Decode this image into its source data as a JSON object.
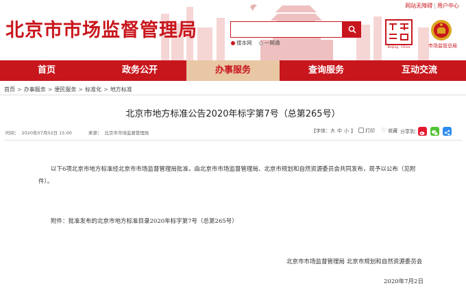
{
  "header": {
    "site_title": "北京市市场监督管理局",
    "top_links": [
      "网站无障碍",
      "用户中心"
    ],
    "search": {
      "placeholder": "",
      "options": [
        "搜本网",
        "一网通"
      ]
    },
    "capital_logo_label": "Beijing · China",
    "emblem_label": "市场监管总局"
  },
  "nav": {
    "items": [
      "首页",
      "政务公开",
      "办事服务",
      "查询服务",
      "互动交流"
    ],
    "active_index": 2
  },
  "breadcrumb": [
    "首页",
    "办事服务",
    "便民服务",
    "标准化",
    "地方标准"
  ],
  "article": {
    "title": "北京市地方标准公告2020年标字第7号（总第265号）",
    "meta": {
      "time_label": "时间：",
      "time_value": "2020年07月02日 15:00",
      "source_label": "来源：",
      "source_value": "北京市市场监督管理局"
    },
    "tools": {
      "font_label": "【字体：",
      "font_large": "大",
      "font_medium": "中",
      "font_small": "小",
      "font_close": "】",
      "print": "打印",
      "favorite": "收藏"
    },
    "share_label": "分享到：",
    "body": "以下6项北京市地方标准经北京市市场监督管理局批准，由北京市市场监督管理局、北京市规划和自然资源委员会共同发布，现予以公布（见附件）。",
    "attachment": "附件：批准发布的北京市地方标准目录2020年标字第7号（总第265号）",
    "signature": "北京市市场监督管理局  北京市规划和自然资源委员会",
    "date": "2020年7月2日"
  },
  "colors": {
    "brand_red": "#c8161d",
    "nav_active_bg": "#e9c7a5"
  }
}
